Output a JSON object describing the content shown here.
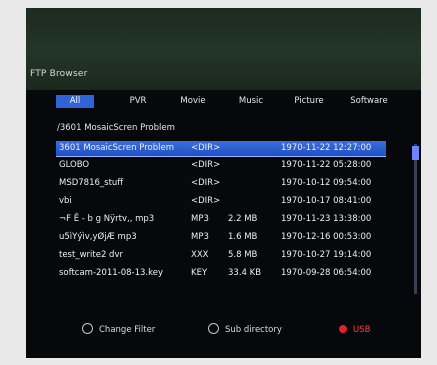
{
  "header": {
    "title": "FTP Browser"
  },
  "tabs": [
    {
      "label": "All",
      "active": true
    },
    {
      "label": "PVR",
      "active": false
    },
    {
      "label": "Movie",
      "active": false
    },
    {
      "label": "Music",
      "active": false
    },
    {
      "label": "Picture",
      "active": false
    },
    {
      "label": "Software",
      "active": false
    }
  ],
  "path": "/3601 MosaicScren Problem",
  "files": [
    {
      "name": "3601 MosaicScren Problem",
      "type": "<DIR>",
      "size": "",
      "date": "1970-11-22 12:27:00",
      "selected": true
    },
    {
      "name": "GLOBO",
      "type": "<DIR>",
      "size": "",
      "date": "1970-11-22 05:28:00",
      "selected": false
    },
    {
      "name": "MSD7816_stuff",
      "type": "<DIR>",
      "size": "",
      "date": "1970-10-12 09:54:00",
      "selected": false
    },
    {
      "name": "vbi",
      "type": "<DIR>",
      "size": "",
      "date": "1970-10-17 08:41:00",
      "selected": false
    },
    {
      "name": "¬F Ê - b g Nÿrtv,, mp3",
      "type": "MP3",
      "size": "2.2 MB",
      "date": "1970-11-23 13:38:00",
      "selected": false
    },
    {
      "name": "u5ìYýìv,yØjÆ mp3",
      "type": "MP3",
      "size": "1.6 MB",
      "date": "1970-12-16 00:53:00",
      "selected": false
    },
    {
      "name": "test_write2 dvr",
      "type": "XXX",
      "size": "5.8 MB",
      "date": "1970-10-27 19:14:00",
      "selected": false
    },
    {
      "name": "softcam-2011-08-13.key",
      "type": "KEY",
      "size": "33.4 KB",
      "date": "1970-09-28 06:54:00",
      "selected": false
    }
  ],
  "footer": {
    "change_filter": "Change Filter",
    "sub_directory": "Sub directory",
    "usb": "USB"
  },
  "colors": {
    "selection": "#2f63d6",
    "usb_red": "#e51f2c",
    "banner": "#233626"
  }
}
